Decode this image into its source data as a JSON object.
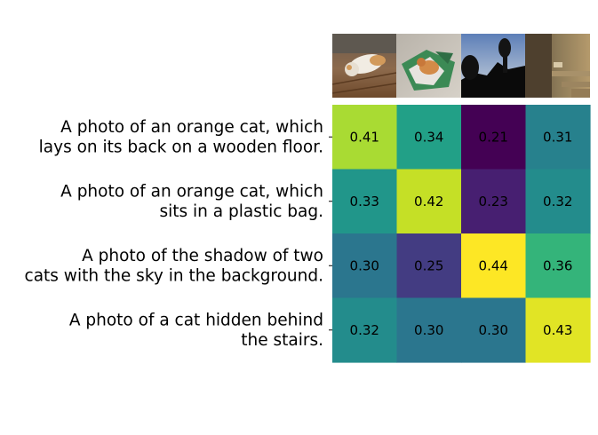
{
  "chart_data": {
    "type": "heatmap",
    "title": "",
    "xlabel": "",
    "ylabel": "",
    "colormap": "viridis",
    "value_range": [
      0.21,
      0.44
    ],
    "columns": [
      {
        "image": "cat-on-back-wooden-floor-photo"
      },
      {
        "image": "cat-in-plastic-bag-photo"
      },
      {
        "image": "cat-shadows-sky-photo"
      },
      {
        "image": "cat-behind-stairs-photo"
      }
    ],
    "rows": [
      [
        "A photo of an orange cat, which",
        "lays on its back on a wooden floor."
      ],
      [
        "A photo of an orange cat, which",
        "sits in a plastic bag."
      ],
      [
        "A photo of the shadow of two",
        "cats with the sky in the background."
      ],
      [
        "A photo of a cat hidden behind",
        "the stairs."
      ]
    ],
    "values": [
      [
        0.41,
        0.34,
        0.21,
        0.31
      ],
      [
        0.33,
        0.42,
        0.23,
        0.32
      ],
      [
        0.3,
        0.25,
        0.44,
        0.36
      ],
      [
        0.32,
        0.3,
        0.3,
        0.43
      ]
    ]
  }
}
